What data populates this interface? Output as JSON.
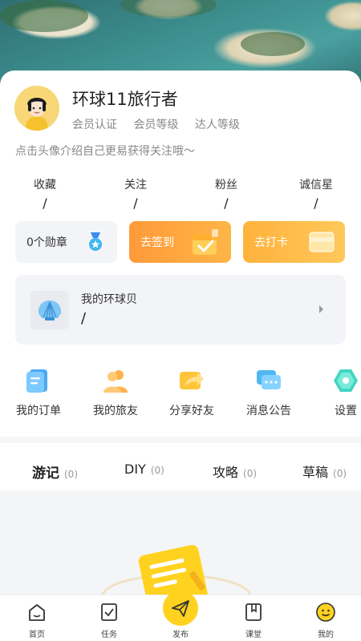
{
  "profile": {
    "name": "环球11旅行者",
    "tags": [
      "会员认证",
      "会员等级",
      "达人等级"
    ],
    "bio": "点击头像介绍自己更易获得关注哦～"
  },
  "stats": [
    {
      "label": "收藏",
      "value": "/"
    },
    {
      "label": "关注",
      "value": "/"
    },
    {
      "label": "粉丝",
      "value": "/"
    },
    {
      "label": "诚信星",
      "value": "/"
    }
  ],
  "actions": {
    "medal_label": "0个勋章",
    "signin_label": "去签到",
    "punch_label": "去打卡"
  },
  "shell": {
    "title": "我的环球贝",
    "value": "/"
  },
  "quick_links": [
    {
      "label": "我的订单",
      "icon": "order-icon"
    },
    {
      "label": "我的旅友",
      "icon": "friends-icon"
    },
    {
      "label": "分享好友",
      "icon": "share-icon"
    },
    {
      "label": "消息公告",
      "icon": "message-icon"
    },
    {
      "label": "设置",
      "icon": "settings-icon"
    }
  ],
  "tabs": [
    {
      "name": "游记",
      "count": "(0)",
      "active": true
    },
    {
      "name": "DIY",
      "count": "(0)"
    },
    {
      "name": "攻略",
      "count": "(0)"
    },
    {
      "name": "草稿",
      "count": "(0)"
    }
  ],
  "bottom_nav": [
    {
      "label": "首页",
      "icon": "home-icon"
    },
    {
      "label": "任务",
      "icon": "task-icon"
    },
    {
      "label": "发布",
      "icon": "send-icon"
    },
    {
      "label": "课堂",
      "icon": "book-icon"
    },
    {
      "label": "我的",
      "icon": "smile-icon"
    }
  ],
  "colors": {
    "accent": "#ffd21f",
    "orange": "#ff9a3a"
  }
}
